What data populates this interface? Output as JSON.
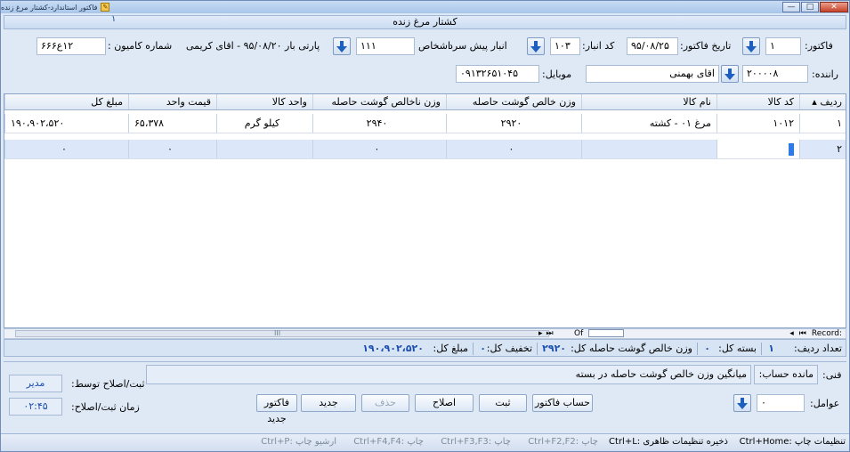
{
  "window": {
    "title": "فاکتور استاندارد-کشتار مرغ زنده",
    "header_number": "۱",
    "header_title": "کشتار مرغ زنده",
    "minimize": "—",
    "maximize": "□",
    "close": "✕"
  },
  "form": {
    "invoice_label": "فاکتور:",
    "invoice_value": "۱",
    "invoice_date_label": "تاریخ فاکتور:",
    "invoice_date_value": "۹۵/۰۸/۲۵",
    "warehouse_code_label": "کد انبار:",
    "warehouse_code_value": "۱۰۳",
    "warehouse_name": "انبار پیش سرد",
    "person_label": "اشخاص",
    "person_value": "۱۱۱",
    "party_label": "پارتی بار ۹۵/۰۸/۲۰ - اقای کریمی",
    "truck_label": "شماره کامیون :",
    "truck_value": "۱۲ع۶۶۶",
    "driver_label": "راننده:",
    "driver_code": "۲۰۰۰۰۸",
    "driver_name": "اقای بهمنی",
    "mobile_label": "موبایل:",
    "mobile_value": "۰۹۱۳۲۶۵۱۰۴۵"
  },
  "grid": {
    "columns": [
      "ردیف",
      "کد کالا",
      "نام کالا",
      "وزن خالص گوشت حاصله",
      "وزن ناخالص گوشت حاصله",
      "واحد کالا",
      "قیمت واحد",
      "مبلغ کل"
    ],
    "rows": [
      {
        "row": "۱",
        "code": "۱۰۱۲",
        "name": "مرغ ۰۱ - کشته",
        "net": "۲۹۲۰",
        "gross": "۲۹۴۰",
        "unit": "کیلو گرم",
        "price": "۶۵،۳۷۸",
        "total": "۱۹۰،۹۰۲،۵۲۰"
      },
      {
        "row": "۲",
        "code": "",
        "name": "",
        "net": "۰",
        "gross": "۰",
        "unit": "",
        "price": "۰",
        "total": "۰"
      }
    ],
    "nav_record": "Record:",
    "nav_of": "Of",
    "scroll_mark": "III"
  },
  "summary": {
    "rows_label": "تعداد ردیف:",
    "rows_value": "۱",
    "packs_label": "بسته کل:",
    "packs_value": "۰",
    "net_label": "وزن خالص گوشت حاصله کل:",
    "net_value": "۲۹۲۰",
    "discount_label": "تخفیف کل:",
    "discount_value": "۰",
    "amount_label": "مبلغ کل:",
    "amount_value": "۱۹۰،۹۰۲،۵۲۰"
  },
  "bottom": {
    "tech_label": "فنی:",
    "balance_label": "مانده حساب:",
    "avg_label": "میانگین وزن خالص گوشت حاصله در بسته",
    "registered_by_label": "ثبت/اصلاح توسط:",
    "registered_by_value": "مدیر",
    "reg_time_label": "زمان ثبت/اصلاح:",
    "reg_time_value": "۰۲:۴۵",
    "factors_label": "عوامل:",
    "factors_value": "۰",
    "btn_account": "حساب فاکتور",
    "btn_save": "ثبت",
    "btn_edit": "اصلاح",
    "btn_delete": "حذف",
    "btn_new": "جدید",
    "btn_new_invoice": "فاکتور جدید"
  },
  "status": {
    "s1": "تنظیمات چاپ :Ctrl+Home",
    "s2": "ذخیره تنظیمات ظاهری :Ctrl+L",
    "s3": "چاپ :Ctrl+F2,F2",
    "s4": "چاپ :Ctrl+F3,F3",
    "s5": "چاپ :Ctrl+F4,F4",
    "s6": "ارشیو چاپ :Ctrl+P"
  }
}
